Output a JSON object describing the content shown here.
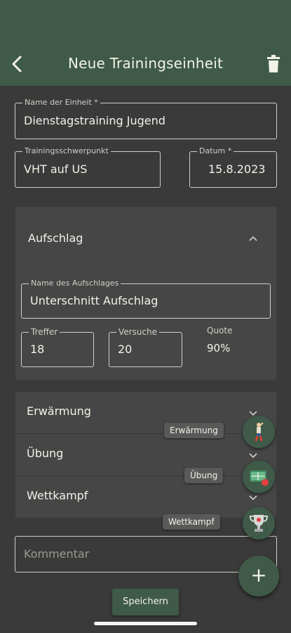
{
  "appbar": {
    "title": "Neue Trainingseinheit"
  },
  "form": {
    "name_label": "Name der Einheit *",
    "name_value": "Dienstagstraining Jugend",
    "focus_label": "Trainingsschwerpunkt",
    "focus_value": "VHT auf US",
    "date_label": "Datum *",
    "date_value": "15.8.2023"
  },
  "aufschlag": {
    "title": "Aufschlag",
    "name_label": "Name des Aufschlages",
    "name_value": "Unterschnitt Aufschlag",
    "treffer_label": "Treffer",
    "treffer_value": "18",
    "versuche_label": "Versuche",
    "versuche_value": "20",
    "quote_label": "Quote",
    "quote_value": "90%"
  },
  "sections": [
    {
      "label": "Erwärmung"
    },
    {
      "label": "Übung"
    },
    {
      "label": "Wettkampf"
    }
  ],
  "comment": {
    "placeholder": "Kommentar"
  },
  "speed_dial": [
    {
      "label": "Erwärmung",
      "icon": "warmup-icon"
    },
    {
      "label": "Übung",
      "icon": "exercise-icon"
    },
    {
      "label": "Wettkampf",
      "icon": "trophy-icon"
    }
  ],
  "fab": {
    "symbol": "+"
  },
  "save_label": "Speichern",
  "colors": {
    "primary": "#3f5a48",
    "background": "#3a3a3a",
    "card": "#464646",
    "text": "#f2f2e8"
  }
}
